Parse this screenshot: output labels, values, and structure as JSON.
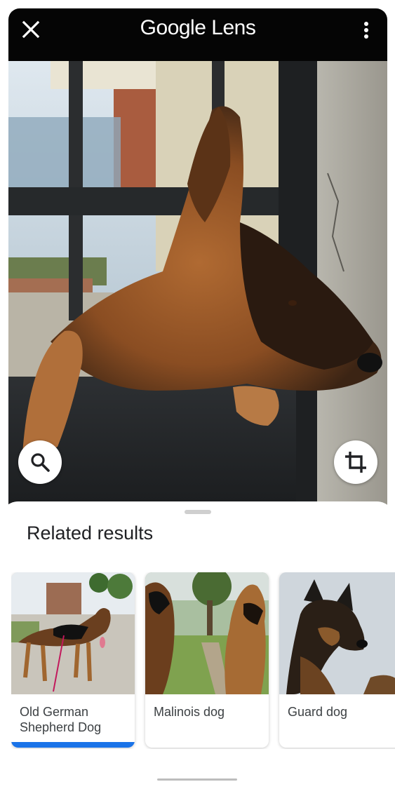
{
  "app": {
    "title_brand": "Google",
    "title_product": "Lens"
  },
  "toolbar": {
    "close_icon": "close-icon",
    "menu_icon": "more-vert-icon"
  },
  "photo_actions": {
    "search_icon": "search-icon",
    "crop_icon": "crop-icon"
  },
  "results": {
    "heading": "Related results",
    "items": [
      {
        "label": "Old German Shepherd Dog",
        "selected": true
      },
      {
        "label": "Malinois dog",
        "selected": false
      },
      {
        "label": "Guard dog",
        "selected": false
      }
    ]
  },
  "colors": {
    "accent": "#1a73e8",
    "toolbar_bg": "#050505"
  }
}
